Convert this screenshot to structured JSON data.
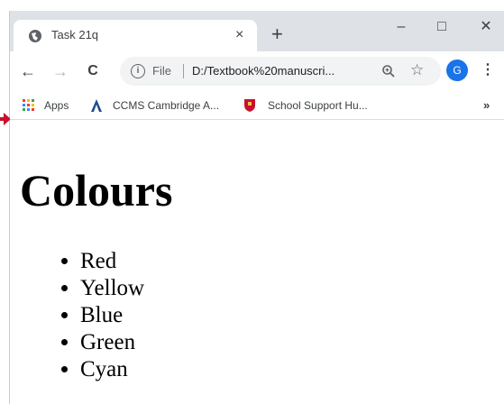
{
  "tab": {
    "title": "Task 21q",
    "close": "×"
  },
  "new_tab": "+",
  "window_controls": {
    "minimize": "–",
    "maximize": "□",
    "close": "✕"
  },
  "toolbar": {
    "back": "←",
    "forward": "→",
    "reload": "C",
    "info": "i",
    "scheme": "File",
    "url": "D:/Textbook%20manuscri...",
    "star": "☆",
    "avatar_letter": "G",
    "menu": "⋮"
  },
  "bookmarks": {
    "items": [
      {
        "label": "Apps",
        "icon": "apps-grid-icon"
      },
      {
        "label": "CCMS Cambridge A...",
        "icon": "ccms-logo-icon"
      },
      {
        "label": "School Support Hu...",
        "icon": "cambridge-shield-icon"
      }
    ],
    "more": "»"
  },
  "page": {
    "heading": "Colours",
    "list": [
      "Red",
      "Yellow",
      "Blue",
      "Green",
      "Cyan"
    ]
  },
  "colors": {
    "titlebar_bg": "#dee1e6",
    "tab_bg": "#ffffff",
    "omnibox_bg": "#f1f3f4",
    "avatar_bg": "#1a73e8",
    "annotation_arrow": "#c8102e"
  }
}
